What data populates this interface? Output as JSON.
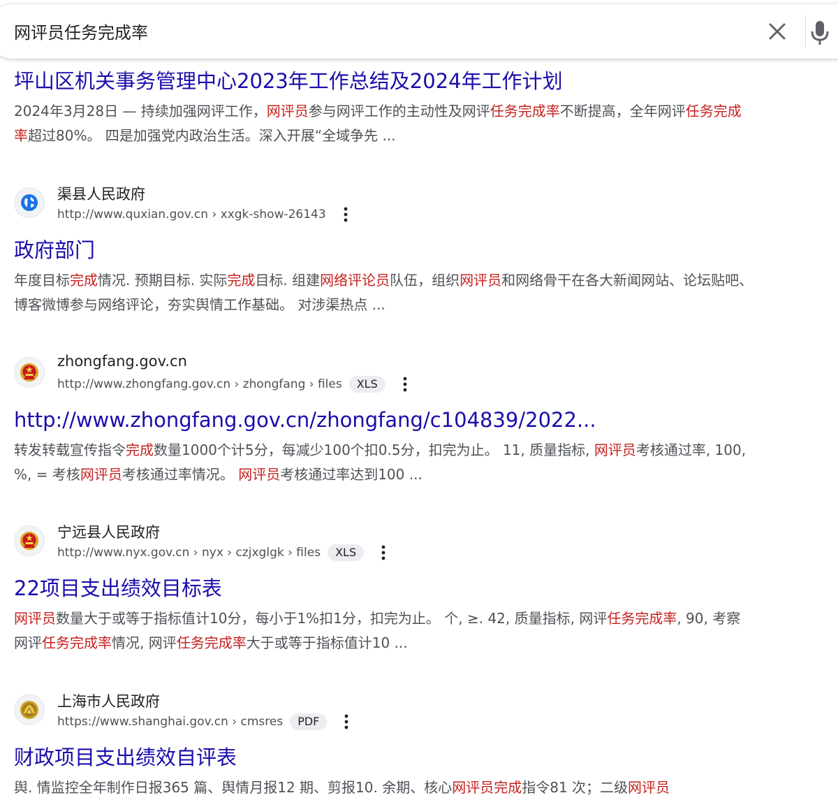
{
  "search": {
    "query": "网评员任务完成率"
  },
  "results": [
    {
      "title": "坪山区机关事务管理中心2023年工作总结及2024年工作计划",
      "snippet": [
        {
          "t": "2024年3月28日 — 持续加强网评工作，"
        },
        {
          "t": "网评员",
          "h": true
        },
        {
          "t": "参与网评工作的主动性及网评"
        },
        {
          "t": "任务完成率",
          "h": true
        },
        {
          "t": "不断提高，全年网评"
        },
        {
          "t": "任务完成率",
          "h": true
        },
        {
          "t": "超过80%。 四是加强党内政治生活。深入开展“全域争先 ..."
        }
      ]
    },
    {
      "site_name": "渠县人民政府",
      "url": "http://www.quxian.gov.cn › xxgk-show-26143",
      "favicon": "globe-icon",
      "title": "政府部门",
      "snippet": [
        {
          "t": "年度目标"
        },
        {
          "t": "完成",
          "h": true
        },
        {
          "t": "情况. 预期目标. 实际"
        },
        {
          "t": "完成",
          "h": true
        },
        {
          "t": "目标. 组建"
        },
        {
          "t": "网络评论员",
          "h": true
        },
        {
          "t": "队伍，组织"
        },
        {
          "t": "网评员",
          "h": true
        },
        {
          "t": "和网络骨干在各大新闻网站、论坛贴吧、博客微博参与网络评论，夯实舆情工作基础。 对涉渠热点 ..."
        }
      ]
    },
    {
      "site_name": "zhongfang.gov.cn",
      "url": "http://www.zhongfang.gov.cn › zhongfang › files",
      "badge": "XLS",
      "favicon": "national-emblem-icon",
      "title": "http://www.zhongfang.gov.cn/zhongfang/c104839/2022...",
      "snippet": [
        {
          "t": "转发转载宣传指令"
        },
        {
          "t": "完成",
          "h": true
        },
        {
          "t": "数量1000个计5分，每减少100个扣0.5分，扣完为止。 11, 质量指标, "
        },
        {
          "t": "网评员",
          "h": true
        },
        {
          "t": "考核通过率, 100, %, = 考核"
        },
        {
          "t": "网评员",
          "h": true
        },
        {
          "t": "考核通过率情况。 "
        },
        {
          "t": "网评员",
          "h": true
        },
        {
          "t": "考核通过率达到100 ..."
        }
      ]
    },
    {
      "site_name": "宁远县人民政府",
      "url": "http://www.nyx.gov.cn › nyx › czjxglgk › files",
      "badge": "XLS",
      "favicon": "national-emblem-icon",
      "title": "22项目支出绩效目标表",
      "snippet": [
        {
          "t": "网评员",
          "h": true
        },
        {
          "t": "数量大于或等于指标值计10分，每小于1%扣1分，扣完为止。 个, ≥. 42, 质量指标, 网评"
        },
        {
          "t": "任务完成率",
          "h": true
        },
        {
          "t": ", 90, 考察网评"
        },
        {
          "t": "任务完成率",
          "h": true
        },
        {
          "t": "情况, 网评"
        },
        {
          "t": "任务完成率",
          "h": true
        },
        {
          "t": "大于或等于指标值计10 ..."
        }
      ]
    },
    {
      "site_name": "上海市人民政府",
      "url": "https://www.shanghai.gov.cn › cmsres",
      "badge": "PDF",
      "favicon": "shanghai-emblem-icon",
      "title": "财政项目支出绩效自评表",
      "snippet": [
        {
          "t": "舆. 情监控全年制作日报365 篇、舆情月报12 期、剪报10. 余期、核心"
        },
        {
          "t": "网评员完成",
          "h": true
        },
        {
          "t": "指令81 次；二级"
        },
        {
          "t": "网评员",
          "h": true
        }
      ]
    }
  ],
  "colors": {
    "link": "#1a0dab",
    "highlight": "#c5221f",
    "text": "#4d5156"
  }
}
